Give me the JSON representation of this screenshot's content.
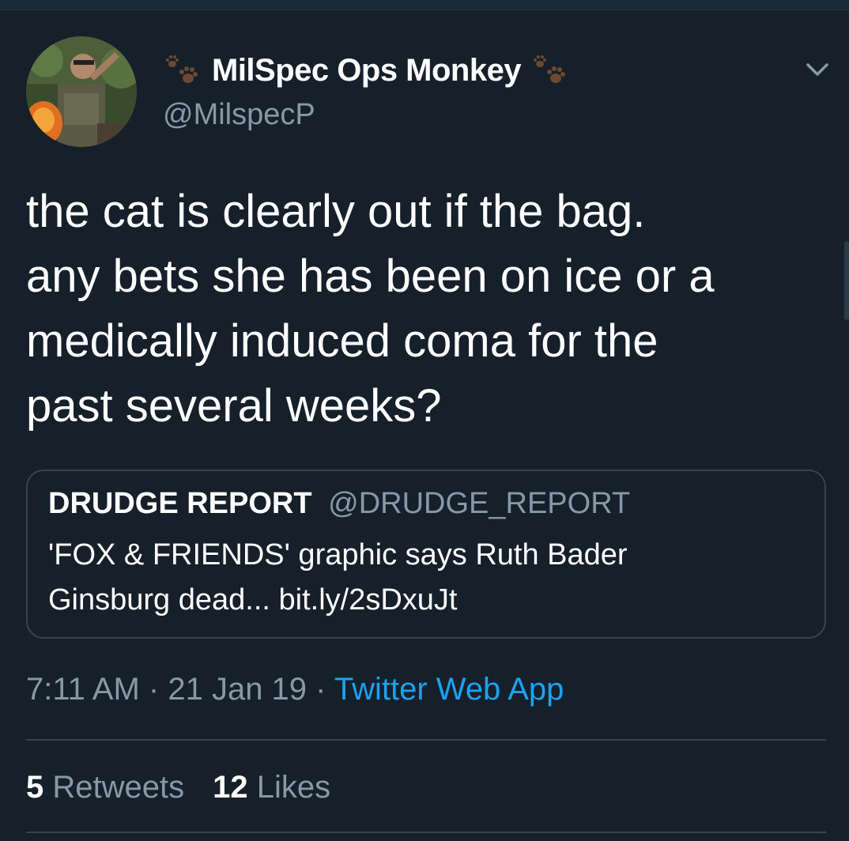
{
  "author": {
    "display_name": "MilSpec Ops Monkey",
    "handle": "@MilspecP",
    "name_emoji": "paw-prints-icon"
  },
  "tweet": {
    "text_lines": [
      "the cat is clearly out if the bag.",
      "any bets she has been on ice or a",
      "medically induced coma for the",
      "past several weeks?"
    ]
  },
  "quoted_tweet": {
    "name": "DRUDGE REPORT",
    "handle": "@DRUDGE_REPORT",
    "text_lines": [
      "'FOX & FRIENDS' graphic says Ruth Bader",
      "Ginsburg dead... bit.ly/2sDxuJt"
    ]
  },
  "meta": {
    "time": "7:11 AM",
    "separator": " · ",
    "date": "21 Jan 19",
    "source": "Twitter Web App"
  },
  "stats": {
    "retweets_count": "5",
    "retweets_label": "Retweets",
    "likes_count": "12",
    "likes_label": "Likes"
  },
  "colors": {
    "background": "#15202b",
    "primary_text": "#ffffff",
    "secondary_text": "#8899a6",
    "accent": "#1da1f2",
    "border": "#38444d"
  }
}
